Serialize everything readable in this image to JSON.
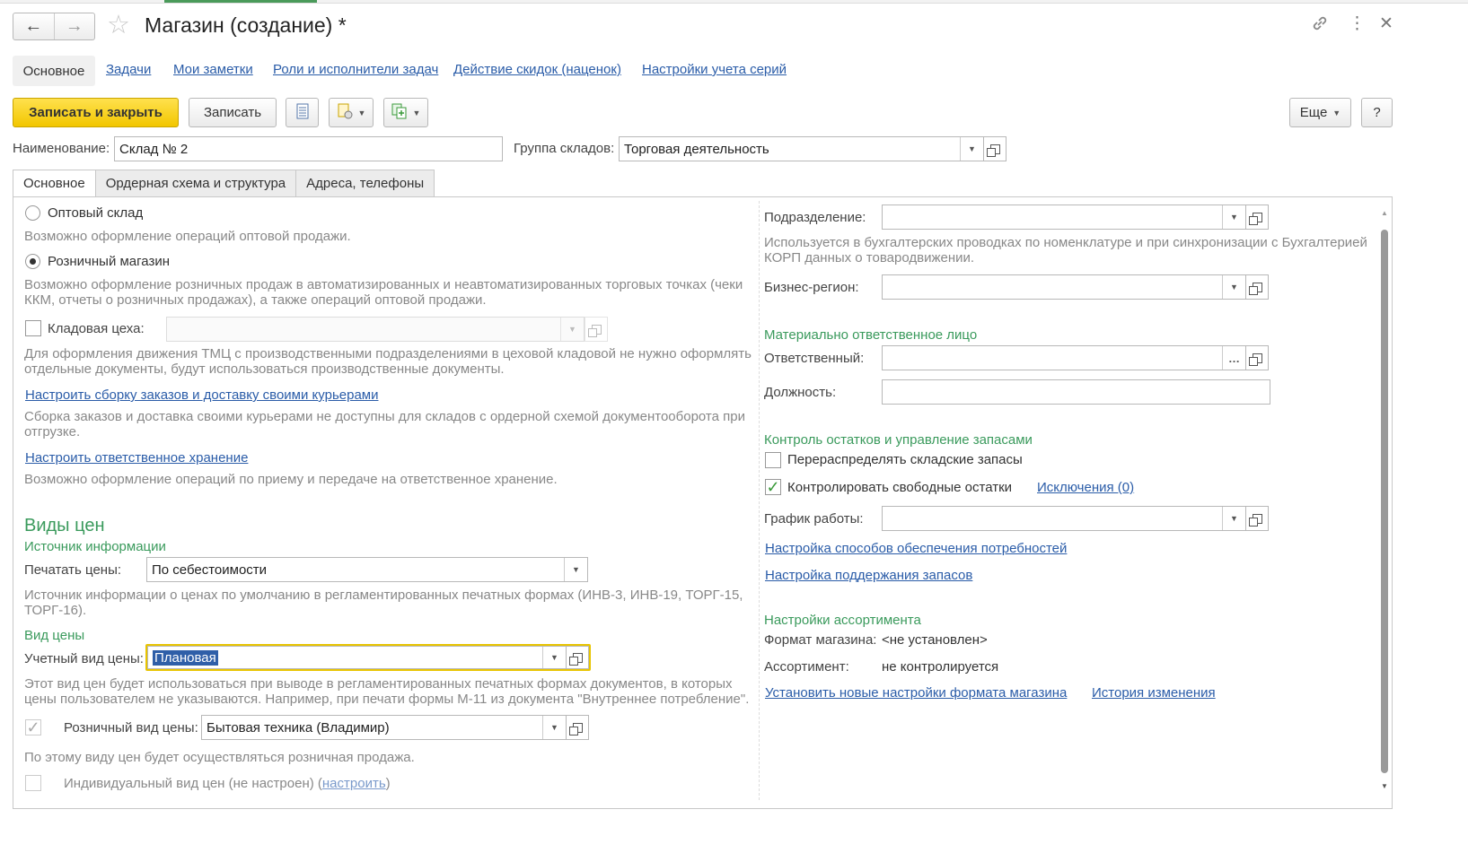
{
  "window": {
    "title": "Магазин (создание) *"
  },
  "section_nav": {
    "active": "Основное",
    "links": [
      "Задачи",
      "Мои заметки",
      "Роли и исполнители задач",
      "Действие скидок (наценок)",
      "Настройки учета серий"
    ]
  },
  "toolbar": {
    "save_close": "Записать и закрыть",
    "save": "Записать",
    "more": "Еще",
    "help": "?"
  },
  "header_fields": {
    "name_label": "Наименование:",
    "name_value": "Склад № 2",
    "group_label": "Группа складов:",
    "group_value": "Торговая деятельность"
  },
  "tabs": [
    "Основное",
    "Ордерная схема и структура",
    "Адреса, телефоны"
  ],
  "left": {
    "wholesale_label": "Оптовый склад",
    "wholesale_hint": "Возможно оформление операций оптовой продажи.",
    "retail_label": "Розничный магазин",
    "retail_hint_1": "Возможно оформление розничных продаж в автоматизированных и неавтоматизированных торговых точках (чеки",
    "retail_hint_2": "ККМ, отчеты о розничных продажах), а также операций оптовой продажи.",
    "workshop_label": "Кладовая цеха:",
    "workshop_hint_1": "Для оформления движения ТМЦ с производственными подразделениями в цеховой кладовой не нужно оформлять",
    "workshop_hint_2": "отдельные документы, будут использоваться производственные документы.",
    "courier_link": "Настроить сборку заказов и доставку своими курьерами",
    "courier_hint_1": "Сборка заказов и доставка своими курьерами не доступны для складов с ордерной схемой документооборота при",
    "courier_hint_2": "отгрузке.",
    "storage_link": "Настроить ответственное хранение",
    "storage_hint": "Возможно оформление операций по приему и передаче на ответственное хранение.",
    "prices_heading": "Виды цен",
    "source_heading": "Источник информации",
    "print_prices_label": "Печатать цены:",
    "print_prices_value": "По себестоимости",
    "print_hint_1": "Источник информации о ценах по умолчанию в регламентированных печатных формах (ИНВ-3, ИНВ-19, ТОРГ-15,",
    "print_hint_2": "ТОРГ-16).",
    "price_type_heading": "Вид цены",
    "account_price_label": "Учетный вид цены:",
    "account_price_value": "Плановая",
    "account_hint_1": "Этот вид цен будет использоваться при выводе в регламентированных печатных формах документов, в которых",
    "account_hint_2": "цены пользователем не указываются. Например, при печати формы М-11 из документа \"Внутреннее потребление\".",
    "retail_price_label": "Розничный вид цены:",
    "retail_price_value": "Бытовая техника (Владимир)",
    "retail_price_hint": "По этому виду цен будет осуществляться розничная продажа.",
    "individual_label": "Индивидуальный вид цен (не настроен) (",
    "individual_link": "настроить",
    "individual_close": ")"
  },
  "right": {
    "division_label": "Подразделение:",
    "division_hint_1": "Используется в бухгалтерских проводках по номенклатуре и при синхронизации с Бухгалтерией",
    "division_hint_2": "КОРП данных о товародвижении.",
    "region_label": "Бизнес-регион:",
    "mol_heading": "Материально ответственное лицо",
    "responsible_label": "Ответственный:",
    "position_label": "Должность:",
    "stock_heading": "Контроль остатков и управление запасами",
    "redistribute_label": "Перераспределять складские запасы",
    "control_label": "Контролировать свободные остатки",
    "exceptions_link": "Исключения (0)",
    "schedule_label": "График работы:",
    "supply_link": "Настройка способов обеспечения потребностей",
    "stock_link": "Настройка поддержания запасов",
    "assortment_heading": "Настройки ассортимента",
    "format_label": "Формат магазина:",
    "format_value": "<не установлен>",
    "assortment_label": "Ассортимент:",
    "assortment_value": "не контролируется",
    "new_format_link": "Установить новые настройки формата магазина",
    "history_link": "История изменения"
  },
  "icons": {
    "back": "arrow-left-icon",
    "forward": "arrow-right-icon",
    "favorite": "star-icon",
    "link": "link-icon",
    "menu": "vertical-dots-icon",
    "close": "close-icon"
  },
  "colors": {
    "primary_button": "#f2c600",
    "section_green": "#3a9a5c",
    "link_blue": "#2a5ca8"
  }
}
